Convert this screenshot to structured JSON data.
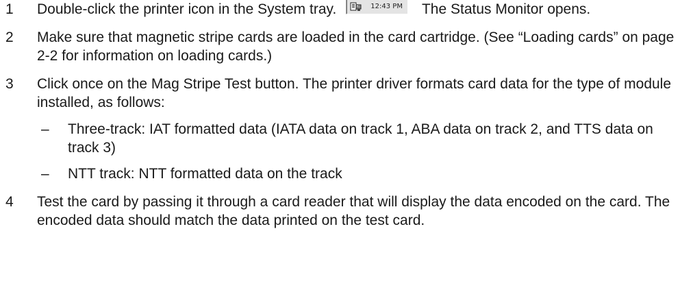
{
  "steps": [
    {
      "number": "1",
      "text_before": "Double-click the printer icon in the System tray.",
      "tray_time": "12:43 PM",
      "text_after": "The Status Monitor opens."
    },
    {
      "number": "2",
      "text": "Make sure that magnetic stripe cards are loaded in the card cartridge. (See “Loading cards” on page 2-2 for information on loading cards.)"
    },
    {
      "number": "3",
      "text": "Click once on the Mag Stripe Test button. The printer driver formats card data for the type of module installed, as follows:",
      "sub_items": [
        {
          "bullet": "–",
          "text": "Three-track: IAT formatted data (IATA data on track 1, ABA data on track 2, and TTS data on track 3)"
        },
        {
          "bullet": "–",
          "text": "NTT track: NTT formatted data on the track"
        }
      ]
    },
    {
      "number": "4",
      "text": "Test the card by passing it through a card reader that will display the data encoded on the card. The encoded data should match the data printed on the test card."
    }
  ],
  "icons": {
    "tray_printer": "printer-icon"
  },
  "colors": {
    "text": "#1a1a1a",
    "tray_background": "#e4e4e4"
  }
}
